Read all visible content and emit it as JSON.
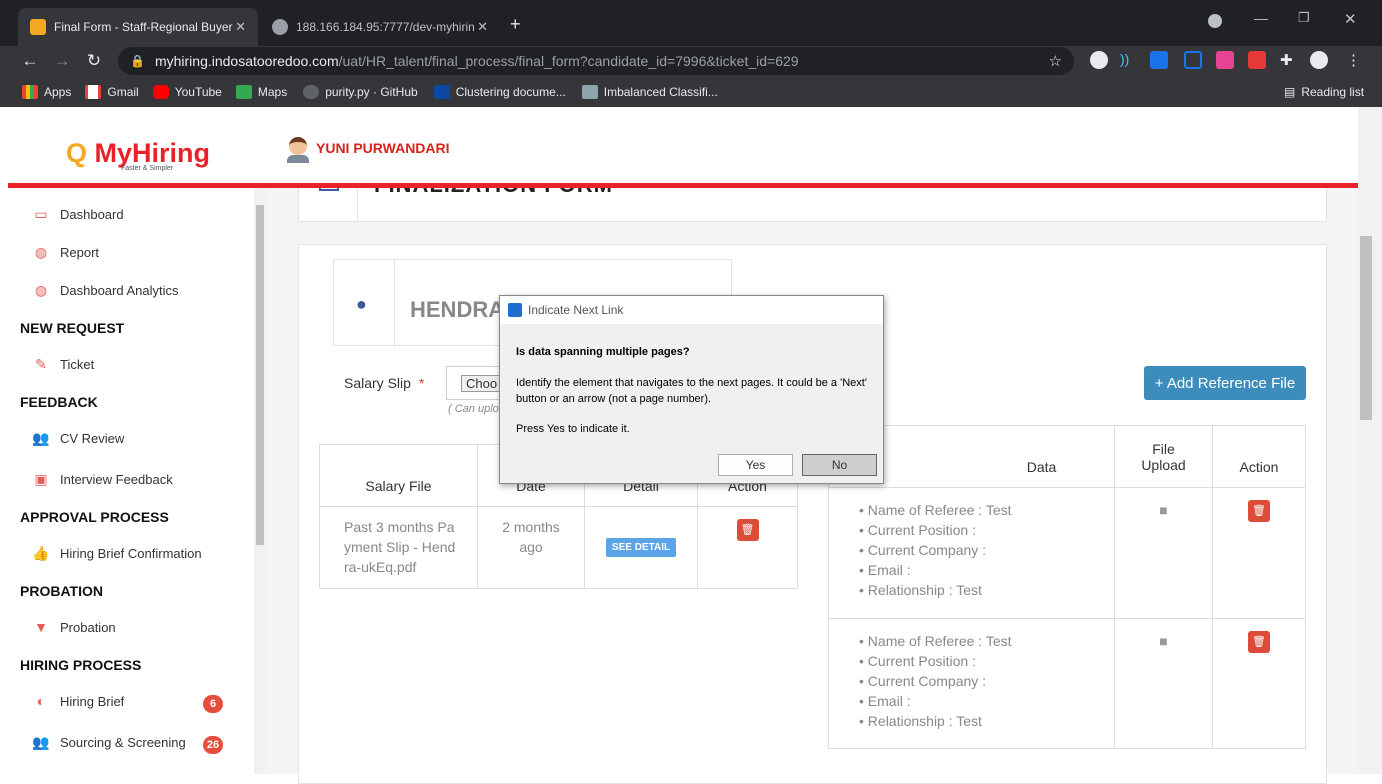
{
  "browser": {
    "tabs": [
      {
        "title": "Final Form - Staff-Regional Buyer"
      },
      {
        "title": "188.166.184.95:7777/dev-myhirin"
      }
    ],
    "url_host": "myhiring.indosatooredoo.com",
    "url_path": "/uat/HR_talent/final_process/final_form?candidate_id=7996&ticket_id=629",
    "bookmarks": [
      "Apps",
      "Gmail",
      "YouTube",
      "Maps",
      "purity.py · GitHub",
      "Clustering docume...",
      "Imbalanced Classifi..."
    ],
    "reading_list": "Reading list"
  },
  "app": {
    "logo": "MyHiring",
    "logo_tagline": "Faster & Simpler",
    "user": "YUNI PURWANDARI"
  },
  "sidebar": {
    "items": [
      {
        "label": "Dashboard",
        "icon": "monitor-icon"
      },
      {
        "label": "Report",
        "icon": "dashboard-gauge-icon"
      },
      {
        "label": "Dashboard Analytics",
        "icon": "dashboard-gauge-icon"
      }
    ],
    "sections": [
      {
        "heading": "NEW REQUEST",
        "items": [
          {
            "label": "Ticket",
            "icon": "ticket-icon"
          }
        ]
      },
      {
        "heading": "FEEDBACK",
        "items": [
          {
            "label": "CV Review",
            "icon": "users-icon"
          },
          {
            "label": "Interview Feedback",
            "icon": "feedback-icon"
          }
        ]
      },
      {
        "heading": "APPROVAL PROCESS",
        "items": [
          {
            "label": "Hiring Brief Confirmation",
            "icon": "thumbs-up-icon"
          }
        ]
      },
      {
        "heading": "PROBATION",
        "items": [
          {
            "label": "Probation",
            "icon": "filter-icon"
          }
        ]
      },
      {
        "heading": "HIRING PROCESS",
        "items": [
          {
            "label": "Hiring Brief",
            "icon": "half-circle-icon",
            "badge": "6"
          },
          {
            "label": "Sourcing & Screening",
            "icon": "users-icon",
            "badge": "26"
          }
        ]
      }
    ]
  },
  "main": {
    "form_title": "FINALIZATION FORM",
    "candidate_name": "HENDRA",
    "salary_slip_label": "Salary Slip",
    "required_mark": "*",
    "choose_button": "Choo",
    "upload_hint": "( Can uplo",
    "add_reference_button": "+ Add Reference File",
    "salary_table": {
      "headers": [
        "Salary File",
        "Date",
        "Detail",
        "Action"
      ],
      "rows": [
        {
          "file": "Past 3 months Payment Slip - Hendra-ukEq.pdf",
          "date": "2 months ago",
          "detail_button": "SEE DETAIL"
        }
      ]
    },
    "reference_table": {
      "headers": [
        "Data",
        "File Upload",
        "Action"
      ],
      "rows": [
        {
          "lines": [
            "Name of Referee : Test",
            "Current Position :",
            "Current Company :",
            "Email :",
            "Relationship : Test"
          ]
        },
        {
          "lines": [
            "Name of Referee : Test",
            "Current Position :",
            "Current Company :",
            "Email :",
            "Relationship : Test"
          ]
        }
      ]
    }
  },
  "dialog": {
    "title": "Indicate Next Link",
    "question": "Is data spanning multiple pages?",
    "body": "Identify the element that navigates to the next pages. It could be a 'Next' button or an arrow (not a page number).",
    "prompt": "Press Yes to indicate it.",
    "yes": "Yes",
    "no": "No"
  }
}
